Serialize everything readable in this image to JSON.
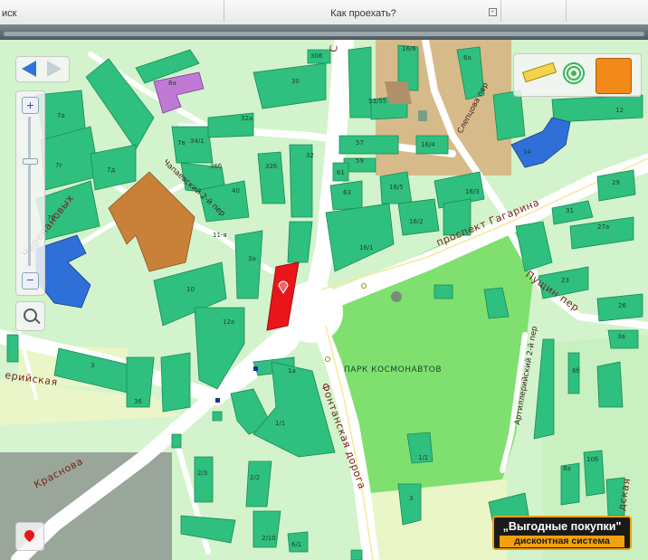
{
  "tabs": {
    "search": "иск",
    "route": "Как проехать?"
  },
  "map": {
    "park_label": "ПАРК КОСМОНАВТОВ",
    "streets": {
      "gagarina": "проспект Гагарина",
      "fontannaya": "Фонтанская дорога",
      "krasnova": "Краснова",
      "chapaeva": "Чапаевский 2-й пер",
      "cherepanovykh": "Черепановых",
      "puschiy": "Пущин пер",
      "artilleriyskaya": "ерийская",
      "artill_per": "Артиллерийский 2-й пер",
      "sleptsova": "Слепцова пер",
      "edge_s": "С",
      "dskaya": "дская"
    },
    "buildings": [
      "306",
      "30",
      "53/55",
      "16/6",
      "34/1",
      "36б",
      "32а",
      "8а",
      "7а",
      "7г",
      "7д",
      "7б",
      "7в",
      "32б",
      "32",
      "40",
      "57",
      "59",
      "16/4",
      "61",
      "63",
      "16/5",
      "16/3",
      "16/2",
      "16/1",
      "11-я",
      "3а",
      "10",
      "12а",
      "3",
      "36",
      "1а",
      "1/1",
      "2/3",
      "2/10",
      "2/2",
      "6/1",
      "1/1",
      "3",
      "6б",
      "12",
      "14",
      "6а",
      "29",
      "27а",
      "31",
      "23",
      "26",
      "3а",
      "10б",
      "8а"
    ],
    "promo": {
      "line1": "„Выгодные покупки\"",
      "line2": "дисконтная система"
    }
  },
  "icons": {
    "back": "arrow-left-icon",
    "forward": "arrow-right-icon",
    "zoom_in": "plus-icon",
    "zoom_out": "minus-icon",
    "magnifier": "magnifier-icon",
    "ruler": "ruler-icon",
    "radar": "radar-icon",
    "view3d": "cube-3d-icon",
    "pin": "map-pin-icon"
  },
  "colors": {
    "building": "#2fbf7f",
    "park": "#7fe06f",
    "road": "#ffffff",
    "marker": "#e8161b",
    "promo_accent": "#f2a00c"
  }
}
